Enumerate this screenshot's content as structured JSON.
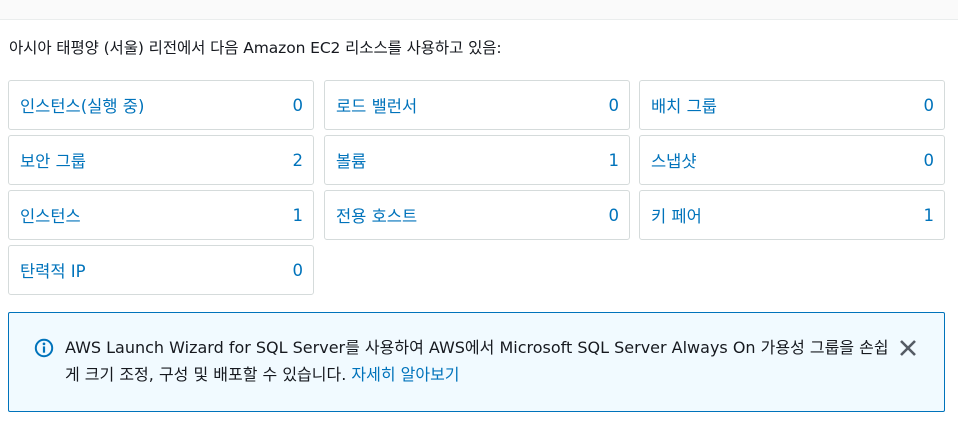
{
  "intro_text": "아시아 태평양 (서울) 리전에서 다음 Amazon EC2 리소스를 사용하고 있음:",
  "resources": [
    {
      "label": "인스턴스(실행 중)",
      "count": "0"
    },
    {
      "label": "로드 밸런서",
      "count": "0"
    },
    {
      "label": "배치 그룹",
      "count": "0"
    },
    {
      "label": "보안 그룹",
      "count": "2"
    },
    {
      "label": "볼륨",
      "count": "1"
    },
    {
      "label": "스냅샷",
      "count": "0"
    },
    {
      "label": "인스턴스",
      "count": "1"
    },
    {
      "label": "전용 호스트",
      "count": "0"
    },
    {
      "label": "키 페어",
      "count": "1"
    },
    {
      "label": "탄력적 IP",
      "count": "0"
    }
  ],
  "info_banner": {
    "message": "AWS Launch Wizard for SQL Server를 사용하여 AWS에서 Microsoft SQL Server Always On 가용성 그룹을 손쉽게 크기 조정, 구성 및 배포할 수 있습니다.",
    "link_text": "자세히 알아보기",
    "icon": "info-icon",
    "close_icon": "close-icon"
  },
  "colors": {
    "link": "#0073bb",
    "banner_background": "#f1faff",
    "banner_border": "#0073bb",
    "tile_border": "#d5dbdb"
  }
}
